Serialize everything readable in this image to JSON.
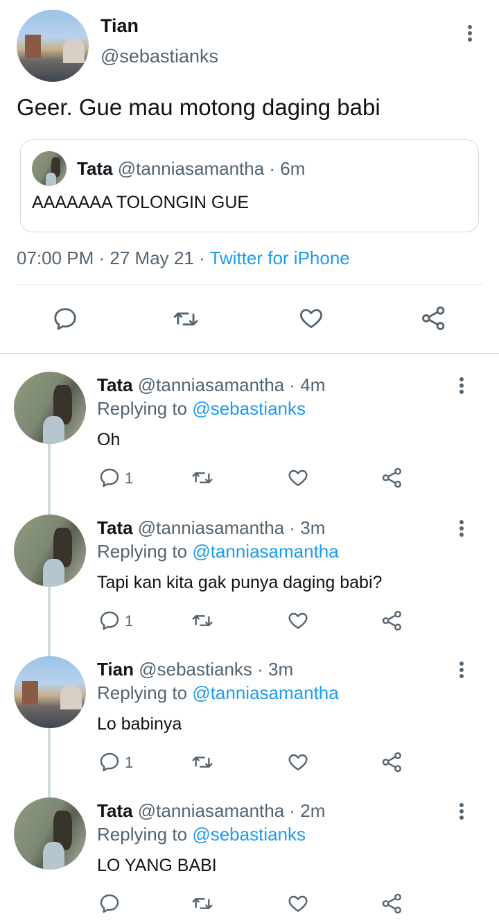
{
  "main_tweet": {
    "author_name": "Tian",
    "author_handle": "@sebastianks",
    "text": "Geer. Gue mau motong daging babi",
    "quote": {
      "author_name": "Tata",
      "author_handle": "@tanniasamantha",
      "time_ago": "· 6m",
      "text": "AAAAAAA TOLONGIN GUE"
    },
    "timestamp": "07:00 PM · 27 May 21 ·",
    "source": "Twitter for iPhone"
  },
  "replies": [
    {
      "author_name": "Tata",
      "author_handle": "@tanniasamantha",
      "time_ago": "· 4m",
      "replying_to_label": "Replying to",
      "replying_to": "@sebastianks",
      "text": "Oh",
      "reply_count": "1",
      "avatar": "room"
    },
    {
      "author_name": "Tata",
      "author_handle": "@tanniasamantha",
      "time_ago": "· 3m",
      "replying_to_label": "Replying to",
      "replying_to": "@tanniasamantha",
      "text": "Tapi kan kita gak punya daging babi?",
      "reply_count": "1",
      "avatar": "room"
    },
    {
      "author_name": "Tian",
      "author_handle": "@sebastianks",
      "time_ago": "· 3m",
      "replying_to_label": "Replying to",
      "replying_to": "@tanniasamantha",
      "text": "Lo babinya",
      "reply_count": "1",
      "avatar": "city"
    },
    {
      "author_name": "Tata",
      "author_handle": "@tanniasamantha",
      "time_ago": "· 2m",
      "replying_to_label": "Replying to",
      "replying_to": "@sebastianks",
      "text": "LO YANG BABI",
      "reply_count": "",
      "avatar": "room"
    }
  ],
  "icons": {
    "reply": "reply-icon",
    "retweet": "retweet-icon",
    "like": "heart-icon",
    "share": "share-icon",
    "more": "more-vertical-icon"
  },
  "colors": {
    "link": "#1d9bf0",
    "muted": "#536471",
    "border": "#cfd9de"
  }
}
